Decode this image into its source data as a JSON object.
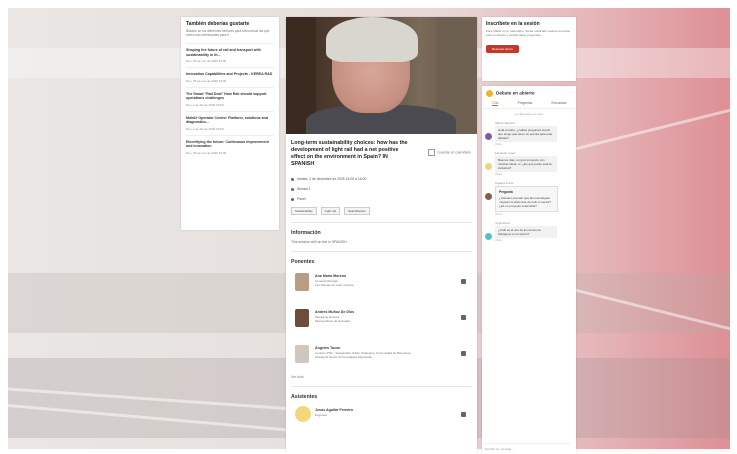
{
  "left_panel": {
    "title": "También deberías gustarte",
    "subtitle": "Basado en los diferentes sectores para seleccionar las que crees más interesantes para ti",
    "items": [
      {
        "title": "Shaping the future of rail and transport with sustainability in th...",
        "date": "Dec, 25 de nov de 2025 16:00"
      },
      {
        "title": "Innovation Capabilities and Projects - KEREA R&D",
        "date": "Dec, 25 de nov de 2025 16:00"
      },
      {
        "title": "The Smart \"Rail Deal\" How Rail should support operations challenges",
        "date": "Dec, 1 de dic de 2025 16:00"
      },
      {
        "title": "Mobile Operator Centre: Platform, solutions and diagnostics...",
        "date": "Dec, 1 de dic de 2025 16:00"
      },
      {
        "title": "Electrifying the future: Continuous improvement and innovation",
        "date": "Dec, 25 de nov de 2025 16:00"
      }
    ]
  },
  "session": {
    "title": "Long-term sustainability choices: how has the development of light rail had a net positive effect on the environment in Spain? IN SPANISH",
    "save_label": "Guardar en calendario",
    "date": "martes, 2 de diciembre de 2025 15:00 a 16:00",
    "stage": "Stream 1",
    "format": "Panel",
    "tags": [
      "Sustainability",
      "Light rail",
      "Spain/Iberian"
    ],
    "info_heading": "Información",
    "info_text": "This session will run live in SPANISH",
    "speakers_heading": "Ponentes",
    "speakers": [
      {
        "name": "Ana María Moreno",
        "role": "General Manager",
        "org": "Las Palmas de Gran Canaria"
      },
      {
        "name": "Andrés Muñoz De Dios",
        "role": "Managing Director",
        "org": "Metropolitano de Granada"
      },
      {
        "name": "Ángeles Tocón",
        "role": "Lecturer PhD - Sustainable Urban Strategies, Universidad de Barcelona",
        "org": "Academia de las Universidades Españolas"
      }
    ],
    "more_label": "Ver todo",
    "attendees_heading": "Asistentes",
    "attendees": [
      {
        "name": "Jesús Aguilar Ferreiro",
        "role": "Engineer"
      }
    ]
  },
  "right_top": {
    "title": "Inscríbete en la sesión",
    "desc": "Para añadir en tu calendario. Serás notificado cuando la sesión esté en directo y podrás hacer preguntas.",
    "button": "Reservar ahora"
  },
  "chat": {
    "title": "Debate en abierto",
    "tabs": [
      "Chat",
      "Preguntas",
      "Encuestas"
    ],
    "intro": "Los Mensajes son aquí",
    "messages": [
      {
        "who": "Alberto Ramírez",
        "text": "Hola a todos, ¿cuáles preguntas creéis que tengo que tener en cuenta para este debate?",
        "time": "Ahora",
        "color": "#7b5ea7"
      },
      {
        "who": "Fernando López",
        "text": "Buenos días, un gran proyecto con muchas ideas, sí. ¿En qué punto está la iniciativa?",
        "time": "Ahora",
        "color": "#f0d37a"
      },
      {
        "who": "Ángeles Tocón",
        "poll_title": "Pregunta",
        "text": "¿Ustedes piensan que las tecnologías mejoran la eficiencia de todo el sector? ¿Es un proyecto sostenible?",
        "time": "Ahora",
        "color": "#8a5a4a"
      },
      {
        "who": "Jorge Pérez",
        "text": "¿Cuál es el uso de los trenes de hidrógeno en el sector?",
        "time": "Ahora",
        "color": "#4fc1c7"
      }
    ],
    "input_placeholder": "Escribir un mensaje..."
  }
}
